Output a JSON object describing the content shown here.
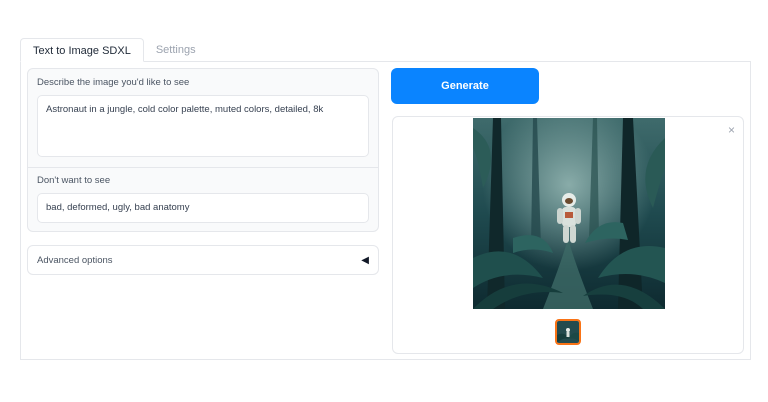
{
  "tabs": [
    {
      "label": "Text to Image SDXL",
      "active": true
    },
    {
      "label": "Settings",
      "active": false
    }
  ],
  "prompt": {
    "label": "Describe the image you'd like to see",
    "value": "Astronaut in a jungle, cold color palette, muted colors, detailed, 8k"
  },
  "negative": {
    "label": "Don't want to see",
    "value": "bad, deformed, ugly, bad anatomy"
  },
  "advanced": {
    "label": "Advanced options",
    "caret": "◀"
  },
  "generate": {
    "label": "Generate"
  },
  "gallery": {
    "close": "×",
    "image_subject": "astronaut walking through a jungle",
    "icons": {
      "close": "close-icon",
      "caret": "caret-left-icon"
    }
  },
  "colors": {
    "accent": "#0a84ff",
    "thumb_border": "#f97316"
  }
}
